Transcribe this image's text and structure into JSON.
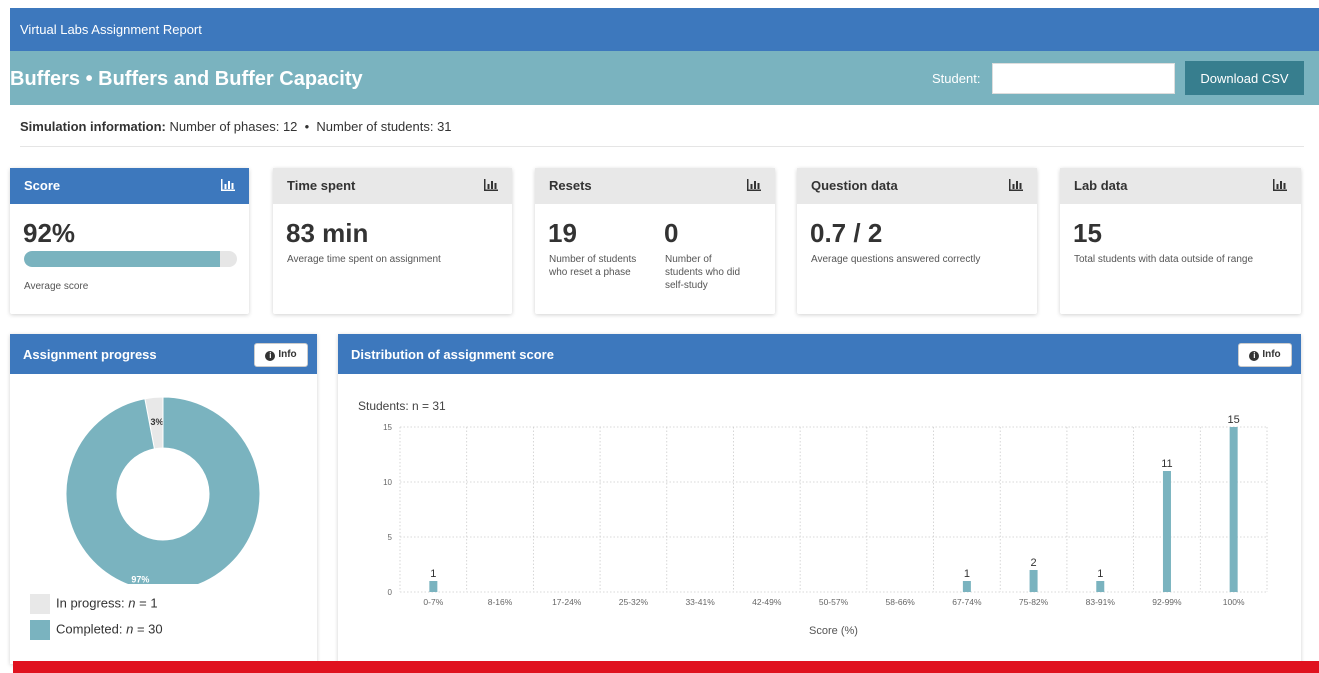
{
  "topbar": {
    "title": "Virtual Labs Assignment Report"
  },
  "header": {
    "title": "Buffers • Buffers and Buffer Capacity",
    "student_label": "Student:",
    "student_value": "",
    "download_label": "Download CSV"
  },
  "simulation_info": {
    "label": "Simulation information:",
    "text": " Number of phases: 12  •  Number of students: 31"
  },
  "cards": {
    "score": {
      "title": "Score",
      "value": "92%",
      "caption": "Average score",
      "progress": 0.92
    },
    "time": {
      "title": "Time spent",
      "value": "83 min",
      "caption": "Average time spent on assignment"
    },
    "resets": {
      "title": "Resets",
      "reset_value": "19",
      "reset_caption": "Number of students who reset a phase",
      "selfstudy_value": "0",
      "selfstudy_caption": "Number of students who did self-study"
    },
    "questions": {
      "title": "Question data",
      "value": "0.7 / 2",
      "caption": "Average questions answered correctly"
    },
    "lab": {
      "title": "Lab data",
      "value": "15",
      "caption": "Total students with data outside of range"
    }
  },
  "progress_panel": {
    "title": "Assignment progress",
    "info_label": "Info",
    "slices": [
      {
        "label": "In progress",
        "n": "1",
        "percent": 3,
        "pct_label": "3%",
        "color": "#e8e8e8"
      },
      {
        "label": "Completed",
        "n": "30",
        "percent": 97,
        "pct_label": "97%",
        "color": "#7ab3bf"
      }
    ]
  },
  "dist_panel": {
    "title": "Distribution of assignment score",
    "info_label": "Info"
  },
  "chart_data": {
    "type": "bar",
    "title": "Students: n = 31",
    "xlabel": "Score (%)",
    "ylabel": "",
    "ylim": [
      0,
      15
    ],
    "yticks": [
      "0",
      "5",
      "10",
      "15"
    ],
    "categories": [
      "0-7%",
      "8-16%",
      "17-24%",
      "25-32%",
      "33-41%",
      "42-49%",
      "50-57%",
      "58-66%",
      "67-74%",
      "75-82%",
      "83-91%",
      "92-99%",
      "100%"
    ],
    "values": [
      1,
      0,
      0,
      0,
      0,
      0,
      0,
      0,
      1,
      2,
      1,
      11,
      15
    ],
    "color": "#7ab3bf",
    "grid": true
  }
}
